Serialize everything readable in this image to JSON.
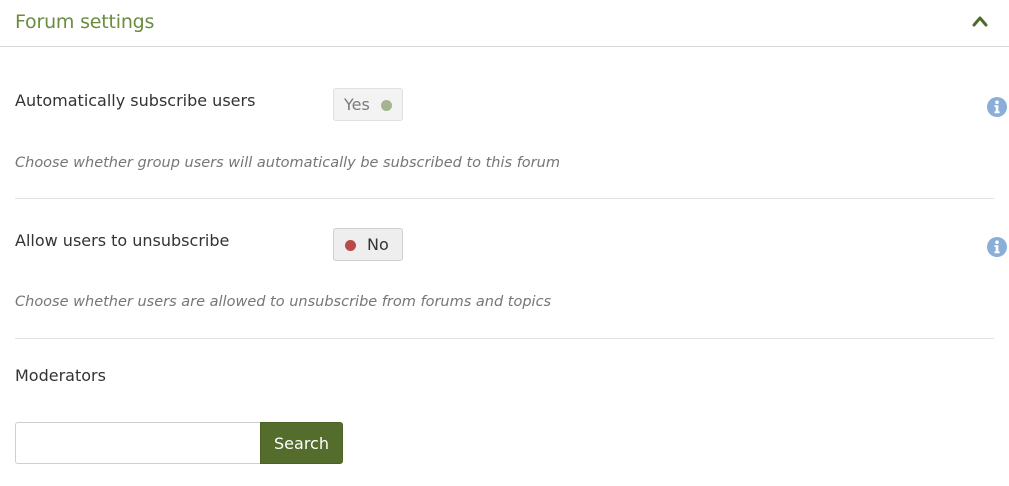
{
  "section": {
    "title": "Forum settings"
  },
  "settings": [
    {
      "label": "Automatically subscribe users",
      "toggle_label": "Yes",
      "toggle_state": "on",
      "help": "Choose whether group users will automatically be subscribed to this forum"
    },
    {
      "label": "Allow users to unsubscribe",
      "toggle_label": "No",
      "toggle_state": "off",
      "help": "Choose whether users are allowed to unsubscribe from forums and topics"
    }
  ],
  "moderators": {
    "label": "Moderators",
    "search_value": "",
    "search_button": "Search"
  },
  "colors": {
    "accent": "#6b8c3e",
    "button": "#546c2c",
    "yes_dot": "#a4b48e",
    "no_dot": "#b94a4a",
    "info_icon": "#8aaed8"
  },
  "icons": {
    "collapse": "chevron-up-icon",
    "info": "info-icon"
  }
}
